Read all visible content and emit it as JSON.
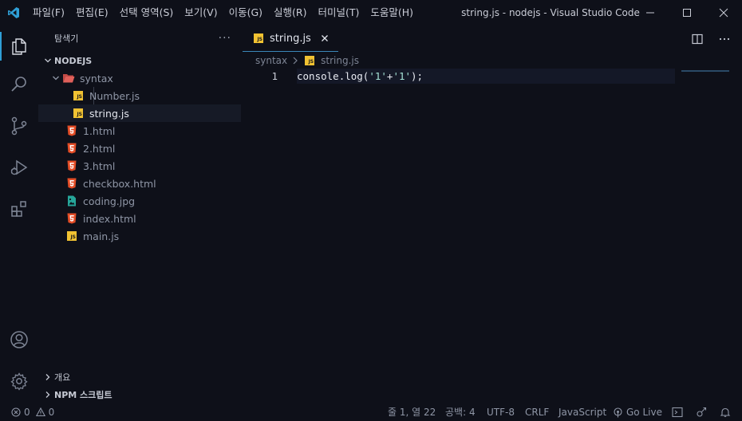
{
  "titlebar": {
    "menu": [
      "파일(F)",
      "편집(E)",
      "선택 영역(S)",
      "보기(V)",
      "이동(G)",
      "실행(R)",
      "터미널(T)",
      "도움말(H)"
    ],
    "window_title": "string.js - nodejs - Visual Studio Code"
  },
  "activity_icons": [
    "explorer-icon",
    "search-icon",
    "source-control-icon",
    "run-debug-icon",
    "extensions-icon",
    "account-icon",
    "settings-gear-icon"
  ],
  "sidebar": {
    "title": "탐색기",
    "more": "···",
    "root": "NODEJS",
    "folder": "syntax",
    "folder_files": [
      "Number.js",
      "string.js"
    ],
    "files": [
      {
        "name": "1.html",
        "icon": "html-icon"
      },
      {
        "name": "2.html",
        "icon": "html-icon"
      },
      {
        "name": "3.html",
        "icon": "html-icon"
      },
      {
        "name": "checkbox.html",
        "icon": "html-icon"
      },
      {
        "name": "coding.jpg",
        "icon": "image-icon"
      },
      {
        "name": "index.html",
        "icon": "html-icon"
      },
      {
        "name": "main.js",
        "icon": "js-icon"
      }
    ],
    "outline": "개요",
    "npm_scripts": "NPM 스크립트"
  },
  "editor": {
    "tab_label": "string.js",
    "breadcrumb": [
      "syntax",
      "string.js"
    ],
    "line_number": "1",
    "code": {
      "fn": "console",
      "dot": ".",
      "method": "log",
      "open": "(",
      "str1": "'1'",
      "plus": "+",
      "str2": "'1'",
      "close": ");"
    }
  },
  "statusbar": {
    "errors": "0",
    "warnings": "0",
    "position": "줄 1, 열 22",
    "spaces": "공백: 4",
    "encoding": "UTF-8",
    "eol": "CRLF",
    "language": "JavaScript",
    "golive": "Go Live"
  },
  "colors": {
    "background": "#0e1019",
    "accent": "#2f9fd6",
    "js_badge": "#f1c232",
    "html_icon": "#e44d26",
    "folder_icon": "#e0605a"
  }
}
